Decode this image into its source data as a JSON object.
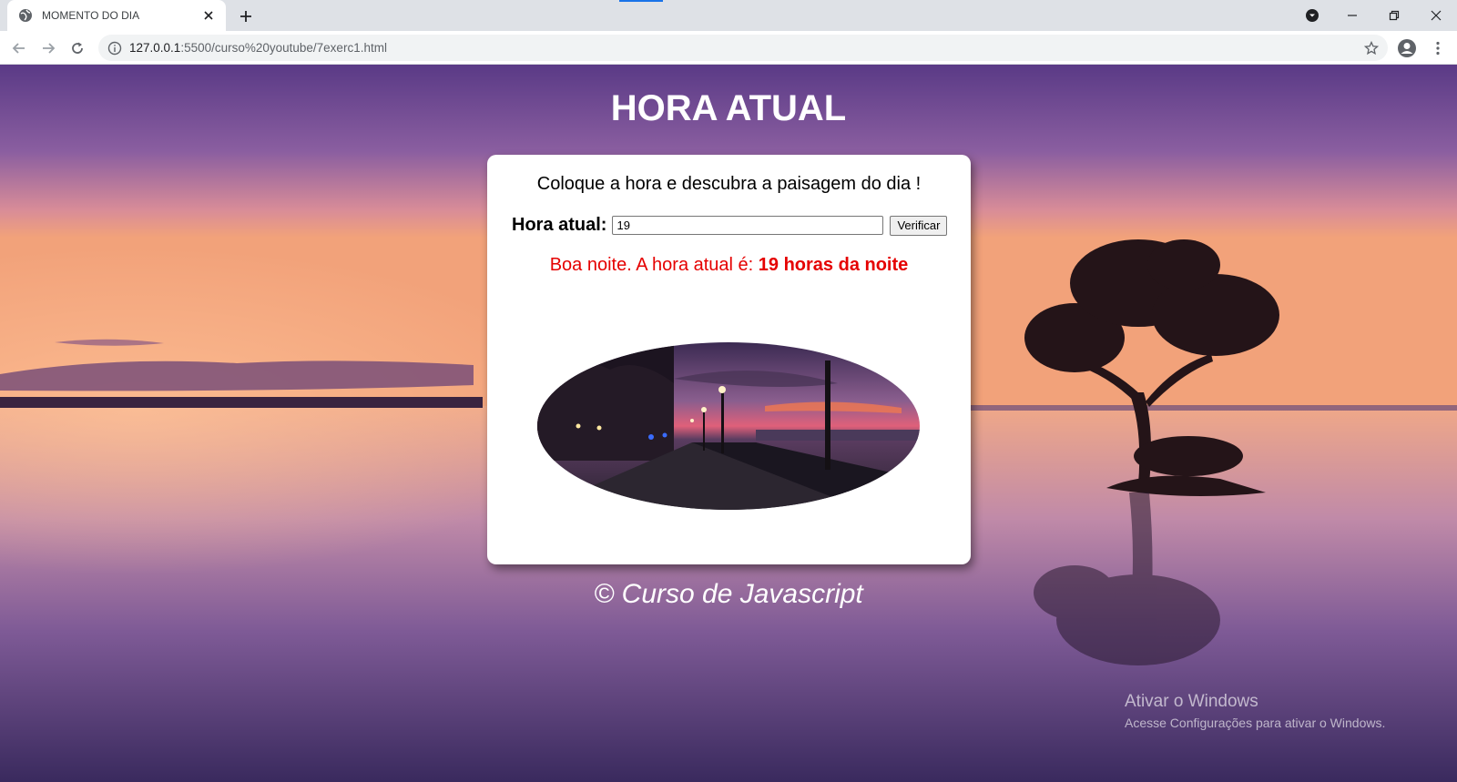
{
  "browser": {
    "tab_title": "MOMENTO DO DIA",
    "url_host": "127.0.0.1",
    "url_rest": ":5500/curso%20youtube/7exerc1.html"
  },
  "page": {
    "heading": "HORA ATUAL",
    "prompt": "Coloque a hora e descubra a paisagem do dia !",
    "input_label": "Hora atual:",
    "input_value": "19",
    "button_label": "Verificar",
    "result_prefix": "Boa noite. A hora atual é: ",
    "result_bold": "19 horas da noite",
    "footer": "© Curso de Javascript"
  },
  "watermark": {
    "title": "Ativar o Windows",
    "subtitle": "Acesse Configurações para ativar o Windows."
  },
  "colors": {
    "result_text": "#e50000",
    "sky_top": "#4a2d72",
    "horizon": "#f2a27a"
  },
  "icons": [
    "globe-icon",
    "close-icon",
    "plus-icon",
    "back-arrow-icon",
    "forward-arrow-icon",
    "reload-icon",
    "info-icon",
    "star-icon",
    "profile-icon",
    "menu-dots-icon",
    "media-dropdown-icon",
    "minimize-icon",
    "restore-icon",
    "window-close-icon"
  ]
}
